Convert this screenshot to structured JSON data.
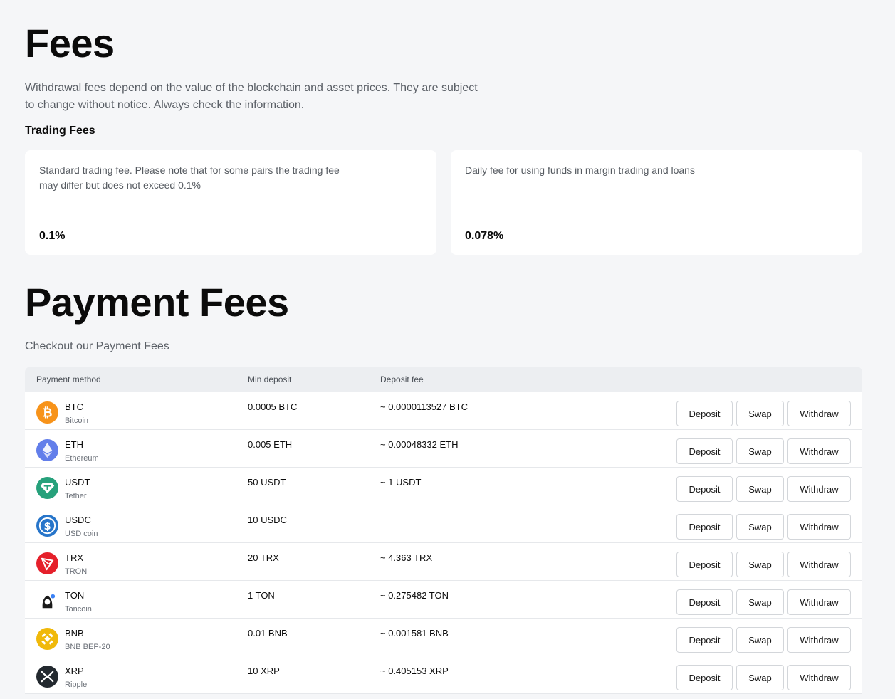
{
  "fees": {
    "title": "Fees",
    "description": "Withdrawal fees depend on the value of the blockchain and asset prices. They are subject to change without notice. Always check the information.",
    "trading_title": "Trading Fees",
    "cards": [
      {
        "description": "Standard trading fee. Please note that for some pairs the trading fee may differ but does not exceed 0.1%",
        "value": "0.1%"
      },
      {
        "description": "Daily fee for using funds in margin trading and loans",
        "value": "0.078%"
      }
    ]
  },
  "payment": {
    "title": "Payment Fees",
    "description": "Checkout our Payment Fees",
    "columns": {
      "method": "Payment method",
      "min_deposit": "Min deposit",
      "deposit_fee": "Deposit fee"
    },
    "buttons": {
      "deposit": "Deposit",
      "swap": "Swap",
      "withdraw": "Withdraw"
    },
    "rows": [
      {
        "symbol": "BTC",
        "name": "Bitcoin",
        "min": "0.0005 BTC",
        "fee": "~ 0.0000113527 BTC",
        "icon": "bitcoin-icon",
        "color": "#f7931a"
      },
      {
        "symbol": "ETH",
        "name": "Ethereum",
        "min": "0.005 ETH",
        "fee": "~ 0.00048332 ETH",
        "icon": "ethereum-icon",
        "color": "#627eea"
      },
      {
        "symbol": "USDT",
        "name": "Tether",
        "min": "50 USDT",
        "fee": "~ 1 USDT",
        "icon": "tether-icon",
        "color": "#26a17b"
      },
      {
        "symbol": "USDC",
        "name": "USD coin",
        "min": "10 USDC",
        "fee": "",
        "icon": "usdc-icon",
        "color": "#2775ca"
      },
      {
        "symbol": "TRX",
        "name": "TRON",
        "min": "20 TRX",
        "fee": "~ 4.363 TRX",
        "icon": "tron-icon",
        "color": "#e5202b"
      },
      {
        "symbol": "TON",
        "name": "Toncoin",
        "min": "1 TON",
        "fee": "~ 0.275482 TON",
        "icon": "toncoin-icon",
        "color": "#1a1a1a"
      },
      {
        "symbol": "BNB",
        "name": "BNB BEP-20",
        "min": "0.01 BNB",
        "fee": "~ 0.001581 BNB",
        "icon": "bnb-icon",
        "color": "#f0b90b"
      },
      {
        "symbol": "XRP",
        "name": "Ripple",
        "min": "10 XRP",
        "fee": "~ 0.405153 XRP",
        "icon": "xrp-icon",
        "color": "#23292f"
      }
    ]
  }
}
